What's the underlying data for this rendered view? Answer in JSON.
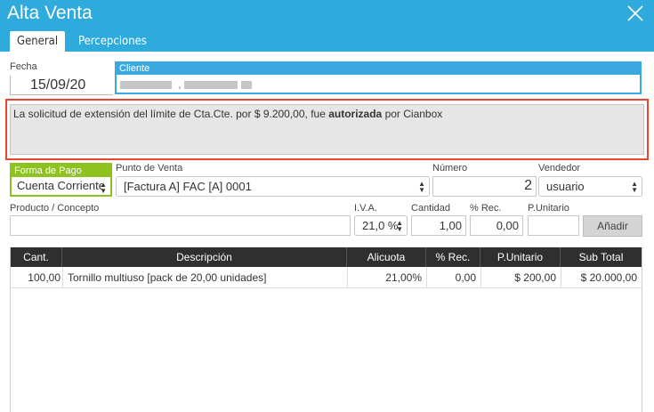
{
  "window": {
    "title": "Alta Venta"
  },
  "tabs": [
    {
      "label": "General",
      "active": true
    },
    {
      "label": "Percepciones",
      "active": false
    }
  ],
  "header": {
    "fecha_label": "Fecha",
    "fecha_value": "15/09/20",
    "cliente_label": "Cliente"
  },
  "alert": {
    "text_prefix": "La solicitud de extensión del límite de Cta.Cte. por $ 9.200,00, fue ",
    "text_bold": "autorizada",
    "text_suffix": " por Cianbox"
  },
  "form": {
    "forma_pago_label": "Forma de Pago",
    "forma_pago_value": "Cuenta Corriente",
    "punto_venta_label": "Punto de Venta",
    "punto_venta_value": "[Factura A] FAC [A] 0001",
    "numero_label": "Número",
    "numero_value": "2",
    "vendedor_label": "Vendedor",
    "vendedor_value": "usuario",
    "producto_label": "Producto / Concepto",
    "producto_value": "",
    "iva_label": "I.V.A.",
    "iva_value": "21,0 %",
    "cantidad_label": "Cantidad",
    "cantidad_value": "1,00",
    "rec_label": "% Rec.",
    "rec_value": "0,00",
    "punitario_label": "P.Unitario",
    "punitario_value": "",
    "add_button": "Añadir"
  },
  "table": {
    "columns": [
      "Cant.",
      "Descripción",
      "Alicuota",
      "% Rec.",
      "P.Unitario",
      "Sub Total"
    ],
    "rows": [
      {
        "cant": "100,00",
        "descripcion": "Tornillo multiuso [pack de 20,00 unidades]",
        "alicuota": "21,00%",
        "rec": "0,00",
        "punitario": "$ 200,00",
        "subtotal": "$ 20.000,00"
      }
    ]
  },
  "colors": {
    "titlebar": "#2eaadc",
    "cliente_accent": "#3ba9e0",
    "forma_pago_accent": "#8dc21f",
    "alert_border": "#e8462e",
    "table_header": "#2f2f2f"
  },
  "icons": {
    "close": "close-icon",
    "select_arrows": "chevron-updown-icon"
  }
}
